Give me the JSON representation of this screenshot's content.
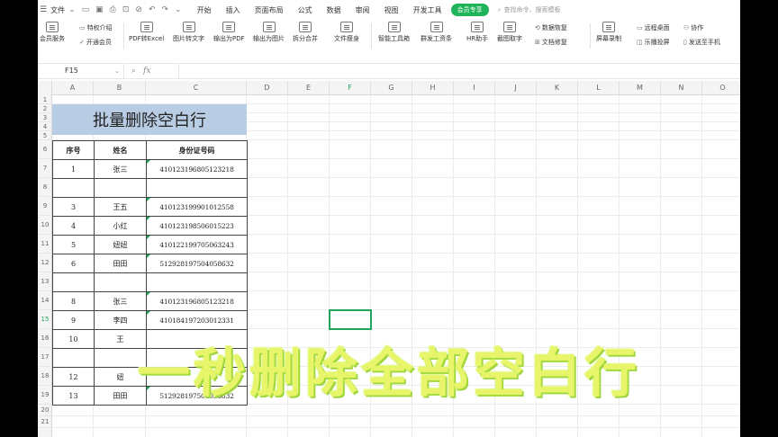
{
  "menu": {
    "file": "文件",
    "tabs": [
      "开始",
      "插入",
      "页面布局",
      "公式",
      "数据",
      "审阅",
      "视图",
      "开发工具"
    ],
    "vip_tab": "会员专享",
    "search_placeholder": "查找命令、搜索模板"
  },
  "ribbon": {
    "member_service": "会员服务",
    "special_privilege": "特权介绍",
    "open_member": "开通会员",
    "pdf_to_excel": "PDF转Excel",
    "image_to_text": "图片转文字",
    "export_pdf": "输出为PDF",
    "export_image": "输出为图片",
    "split_merge": "拆分合并",
    "file_slim": "文件瘦身",
    "smart_toolbox": "智能工具箱",
    "group_resources": "群发工资条",
    "hr_assistant": "HR助手",
    "screenshot_ocr": "截图取字",
    "data_recovery": "数据恢复",
    "doc_repair": "文档修复",
    "screen_record": "屏幕录制",
    "remote_desktop": "远程桌面",
    "easy_projection": "乐播投屏",
    "collaborate": "协作",
    "send_to_phone": "发送至手机"
  },
  "formula_bar": {
    "cell_ref": "F15",
    "fx": "fx",
    "value": ""
  },
  "columns": [
    "A",
    "B",
    "C",
    "D",
    "E",
    "F",
    "G",
    "H",
    "I",
    "J",
    "K",
    "L",
    "M",
    "N",
    "O"
  ],
  "selected_column": "F",
  "rows": [
    "1",
    "2",
    "3",
    "4",
    "5",
    "6",
    "7",
    "8",
    "9",
    "10",
    "11",
    "12",
    "13",
    "14",
    "15",
    "16",
    "17",
    "18",
    "19",
    "20",
    "21"
  ],
  "selected_row": "15",
  "sheet": {
    "title": "批量删除空白行",
    "headers": [
      "序号",
      "姓名",
      "身份证号码"
    ],
    "records": [
      {
        "no": "1",
        "name": "张三",
        "id": "410123196805123218"
      },
      {
        "no": "",
        "name": "",
        "id": ""
      },
      {
        "no": "3",
        "name": "王五",
        "id": "410123199901012558"
      },
      {
        "no": "4",
        "name": "小红",
        "id": "410123198506015223"
      },
      {
        "no": "5",
        "name": "妞妞",
        "id": "410122199705063243"
      },
      {
        "no": "6",
        "name": "田田",
        "id": "512928197504058632"
      },
      {
        "no": "",
        "name": "",
        "id": ""
      },
      {
        "no": "8",
        "name": "张三",
        "id": "410123196805123218"
      },
      {
        "no": "9",
        "name": "李四",
        "id": "410184197203012331"
      },
      {
        "no": "10",
        "name": "王",
        "id": ""
      },
      {
        "no": "",
        "name": "",
        "id": ""
      },
      {
        "no": "12",
        "name": "妞",
        "id": ""
      },
      {
        "no": "13",
        "name": "田田",
        "id": "512928197504058632"
      }
    ]
  },
  "overlay_caption": "一秒删除全部空白行",
  "colors": {
    "accent": "#1fa55b",
    "title_fill": "#b8cce4",
    "caption": "#e8f56a"
  }
}
